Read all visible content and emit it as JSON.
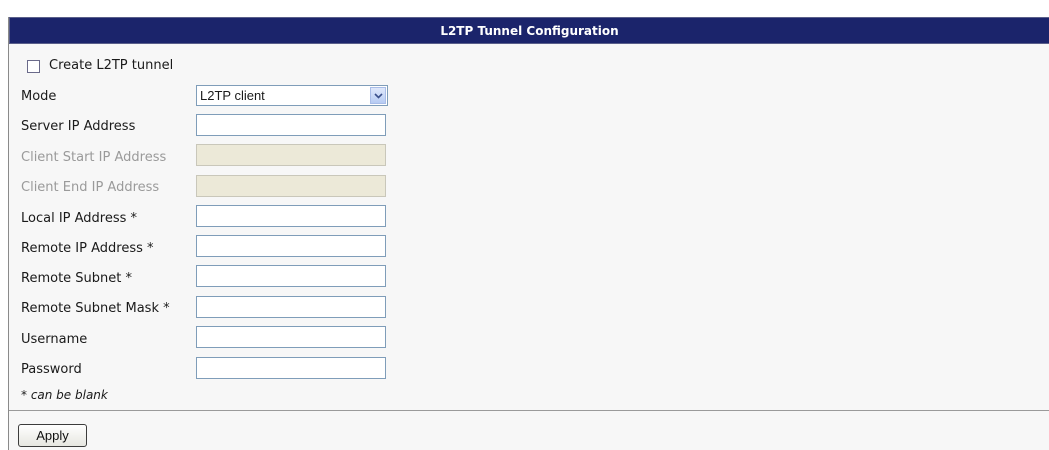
{
  "title": "L2TP Tunnel Configuration",
  "create_tunnel": {
    "label": "Create L2TP tunnel",
    "checked": false
  },
  "mode": {
    "label": "Mode",
    "value": "L2TP client"
  },
  "fields": {
    "server_ip": {
      "label": "Server IP Address",
      "value": ""
    },
    "client_start_ip": {
      "label": "Client Start IP Address",
      "value": ""
    },
    "client_end_ip": {
      "label": "Client End IP Address",
      "value": ""
    },
    "local_ip": {
      "label": "Local IP Address *",
      "value": ""
    },
    "remote_ip": {
      "label": "Remote IP Address *",
      "value": ""
    },
    "remote_subnet": {
      "label": "Remote Subnet *",
      "value": ""
    },
    "remote_subnet_mask": {
      "label": "Remote Subnet Mask *",
      "value": ""
    },
    "username": {
      "label": "Username",
      "value": ""
    },
    "password": {
      "label": "Password",
      "value": ""
    }
  },
  "note": "* can be blank",
  "apply_label": "Apply",
  "colors": {
    "titlebar": "#1b246b",
    "panel": "#f7f7f7",
    "disabled_field": "#ece9d8"
  },
  "icons": {
    "select_arrow": "chevron-down-icon"
  }
}
